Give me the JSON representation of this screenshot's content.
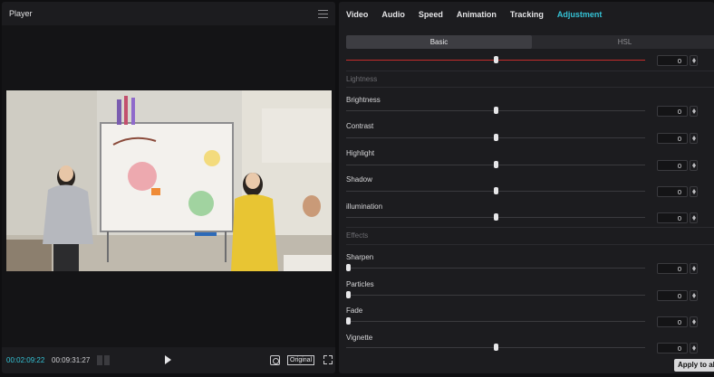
{
  "player": {
    "title": "Player",
    "current_time": "00:02:09:22",
    "total_time": "00:09:31:27",
    "original_label": "Original"
  },
  "inspector": {
    "tabs": [
      {
        "label": "Video"
      },
      {
        "label": "Audio"
      },
      {
        "label": "Speed"
      },
      {
        "label": "Animation"
      },
      {
        "label": "Tracking"
      },
      {
        "label": "Adjustment",
        "active": true
      }
    ],
    "subtabs": [
      "Basic",
      "HSL"
    ],
    "active_subtab": "Basic",
    "top_row": {
      "value": "0",
      "position": 0.5
    },
    "lightness": {
      "heading": "Lightness",
      "rows": [
        {
          "label": "Brightness",
          "value": "0",
          "position": 0.5
        },
        {
          "label": "Contrast",
          "value": "0",
          "position": 0.5
        },
        {
          "label": "Highlight",
          "value": "0",
          "position": 0.5
        },
        {
          "label": "Shadow",
          "value": "0",
          "position": 0.5
        },
        {
          "label": "illumination",
          "value": "0",
          "position": 0.5
        }
      ]
    },
    "effects": {
      "heading": "Effects",
      "rows": [
        {
          "label": "Sharpen",
          "value": "0",
          "position": 0.0
        },
        {
          "label": "Particles",
          "value": "0",
          "position": 0.0
        },
        {
          "label": "Fade",
          "value": "0",
          "position": 0.0
        },
        {
          "label": "Vignette",
          "value": "0",
          "position": 0.5
        }
      ]
    },
    "apply_label": "Apply to all"
  },
  "colors": {
    "accent": "#35c3d6",
    "slider_highlight": "#c42c2c"
  },
  "icons": [
    "menu-icon",
    "grid-icon",
    "play-icon",
    "fit-icon",
    "fullscreen-icon",
    "stepper-icon"
  ]
}
